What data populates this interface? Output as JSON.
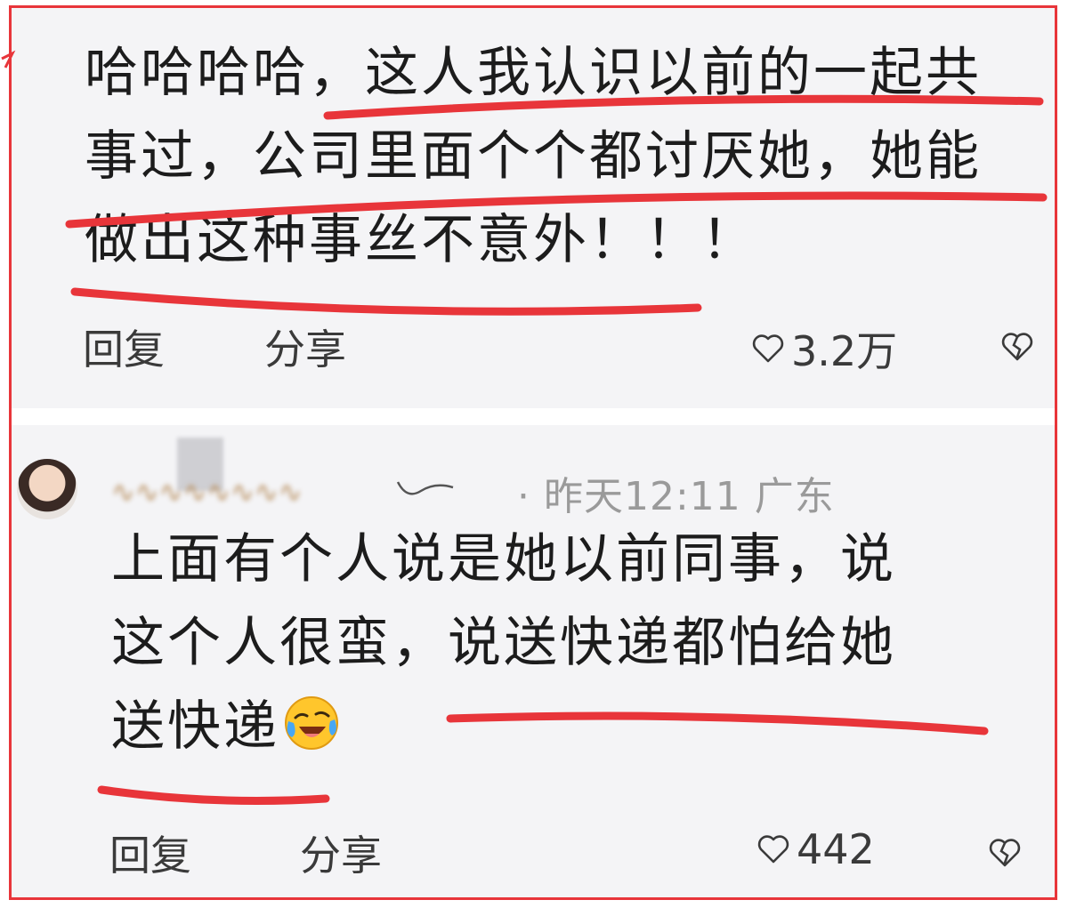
{
  "colors": {
    "highlight": "#e8353a",
    "card_bg": "#f4f4f6",
    "meta": "#9a9a9a"
  },
  "comment1": {
    "lines": [
      "哈哈哈哈，这人我认识以前的一起共",
      "事过，公司里面个个都讨厌她，她能",
      "做出这种事丝不意外！！！"
    ],
    "reply": "回复",
    "share": "分享",
    "likes": "3.2万",
    "like_icon": "heart-outline-icon",
    "dislike_icon": "broken-heart-icon"
  },
  "comment2": {
    "time_location": "· 昨天12:11 广东",
    "lines": [
      "上面有个人说是她以前同事，说",
      "这个人很蛮，说送快递都怕给她",
      "送快递"
    ],
    "emoji": "laughing-crying-emoji",
    "reply": "回复",
    "share": "分享",
    "likes": "442",
    "like_icon": "heart-outline-icon",
    "dislike_icon": "broken-heart-icon"
  }
}
